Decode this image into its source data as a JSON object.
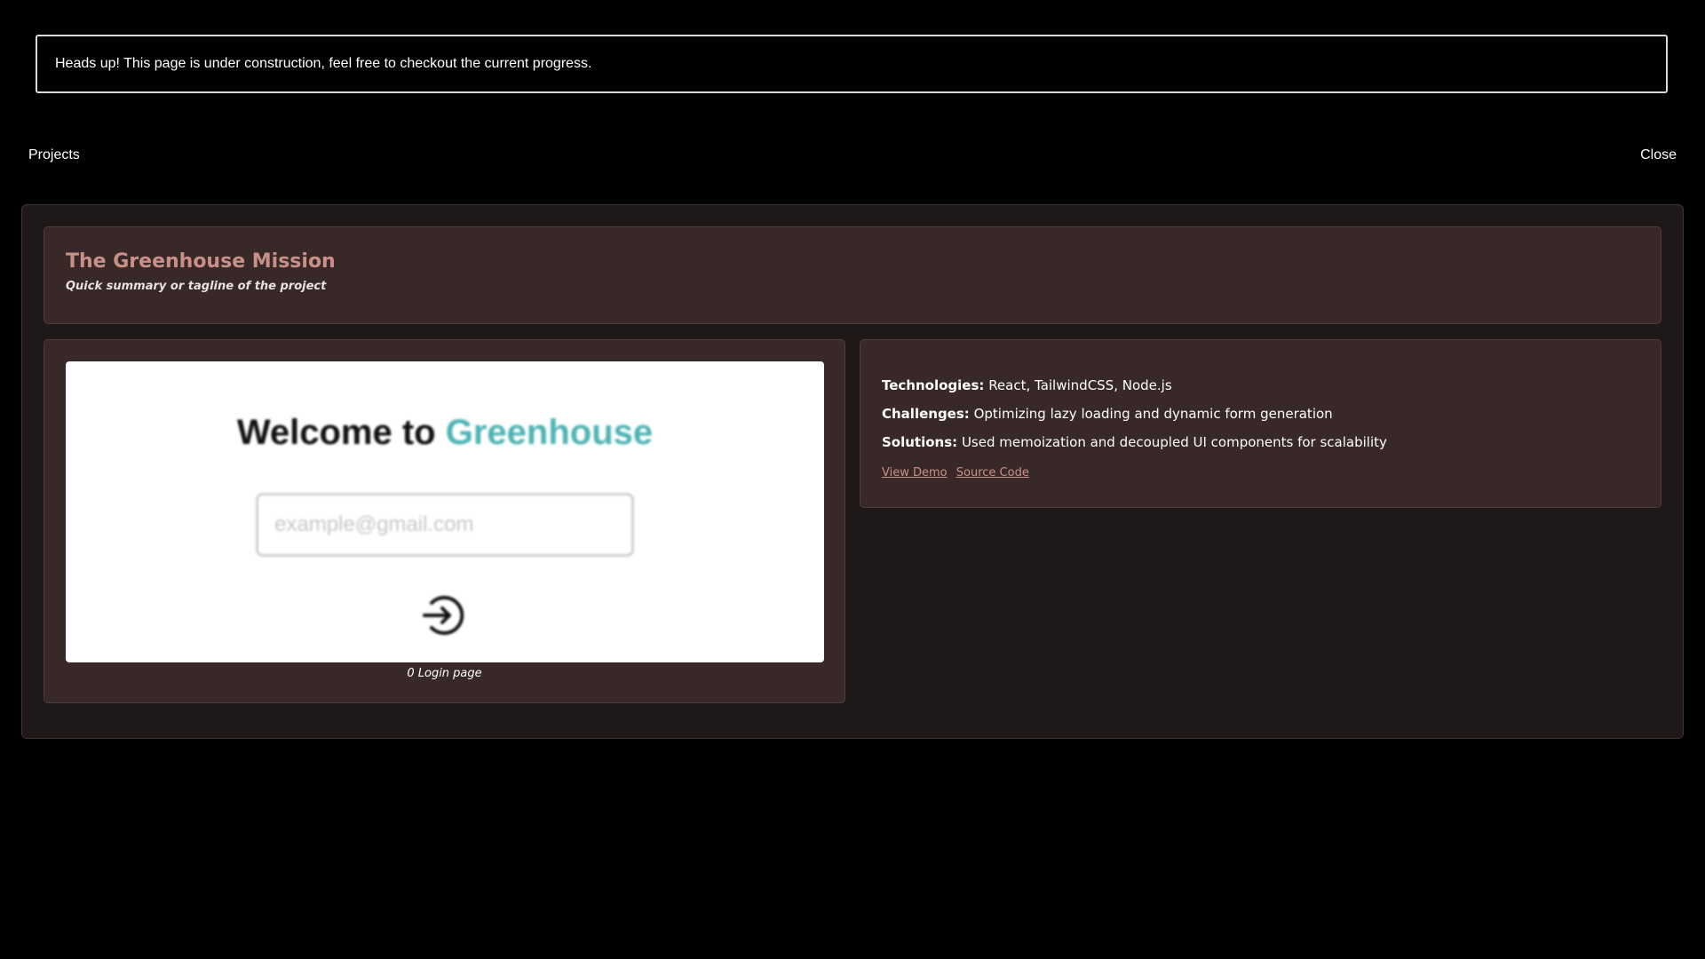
{
  "banner": {
    "text": "Heads up! This page is under construction, feel free to checkout the current progress."
  },
  "topbar": {
    "title": "Projects",
    "close_label": "Close"
  },
  "project": {
    "title": "The Greenhouse Mission",
    "tagline": "Quick summary or tagline of the project",
    "preview": {
      "heading_prefix": "Welcome to",
      "heading_accent": "Greenhouse",
      "input_placeholder": "example@gmail.com",
      "icon": "login-arrow-icon"
    },
    "caption": "0 Login page",
    "details": {
      "technologies_label": "Technologies:",
      "technologies_value": "React, TailwindCSS, Node.js",
      "challenges_label": "Challenges:",
      "challenges_value": "Optimizing lazy loading and dynamic form generation",
      "solutions_label": "Solutions:",
      "solutions_value": "Used memoization and decoupled UI components for scalability"
    },
    "links": {
      "demo_label": "View Demo",
      "source_label": "Source Code"
    }
  },
  "colors": {
    "background": "#000000",
    "panel": "#1f1818",
    "card": "#382828",
    "accent": "#c99088",
    "preview_accent": "#4fb3b3"
  }
}
